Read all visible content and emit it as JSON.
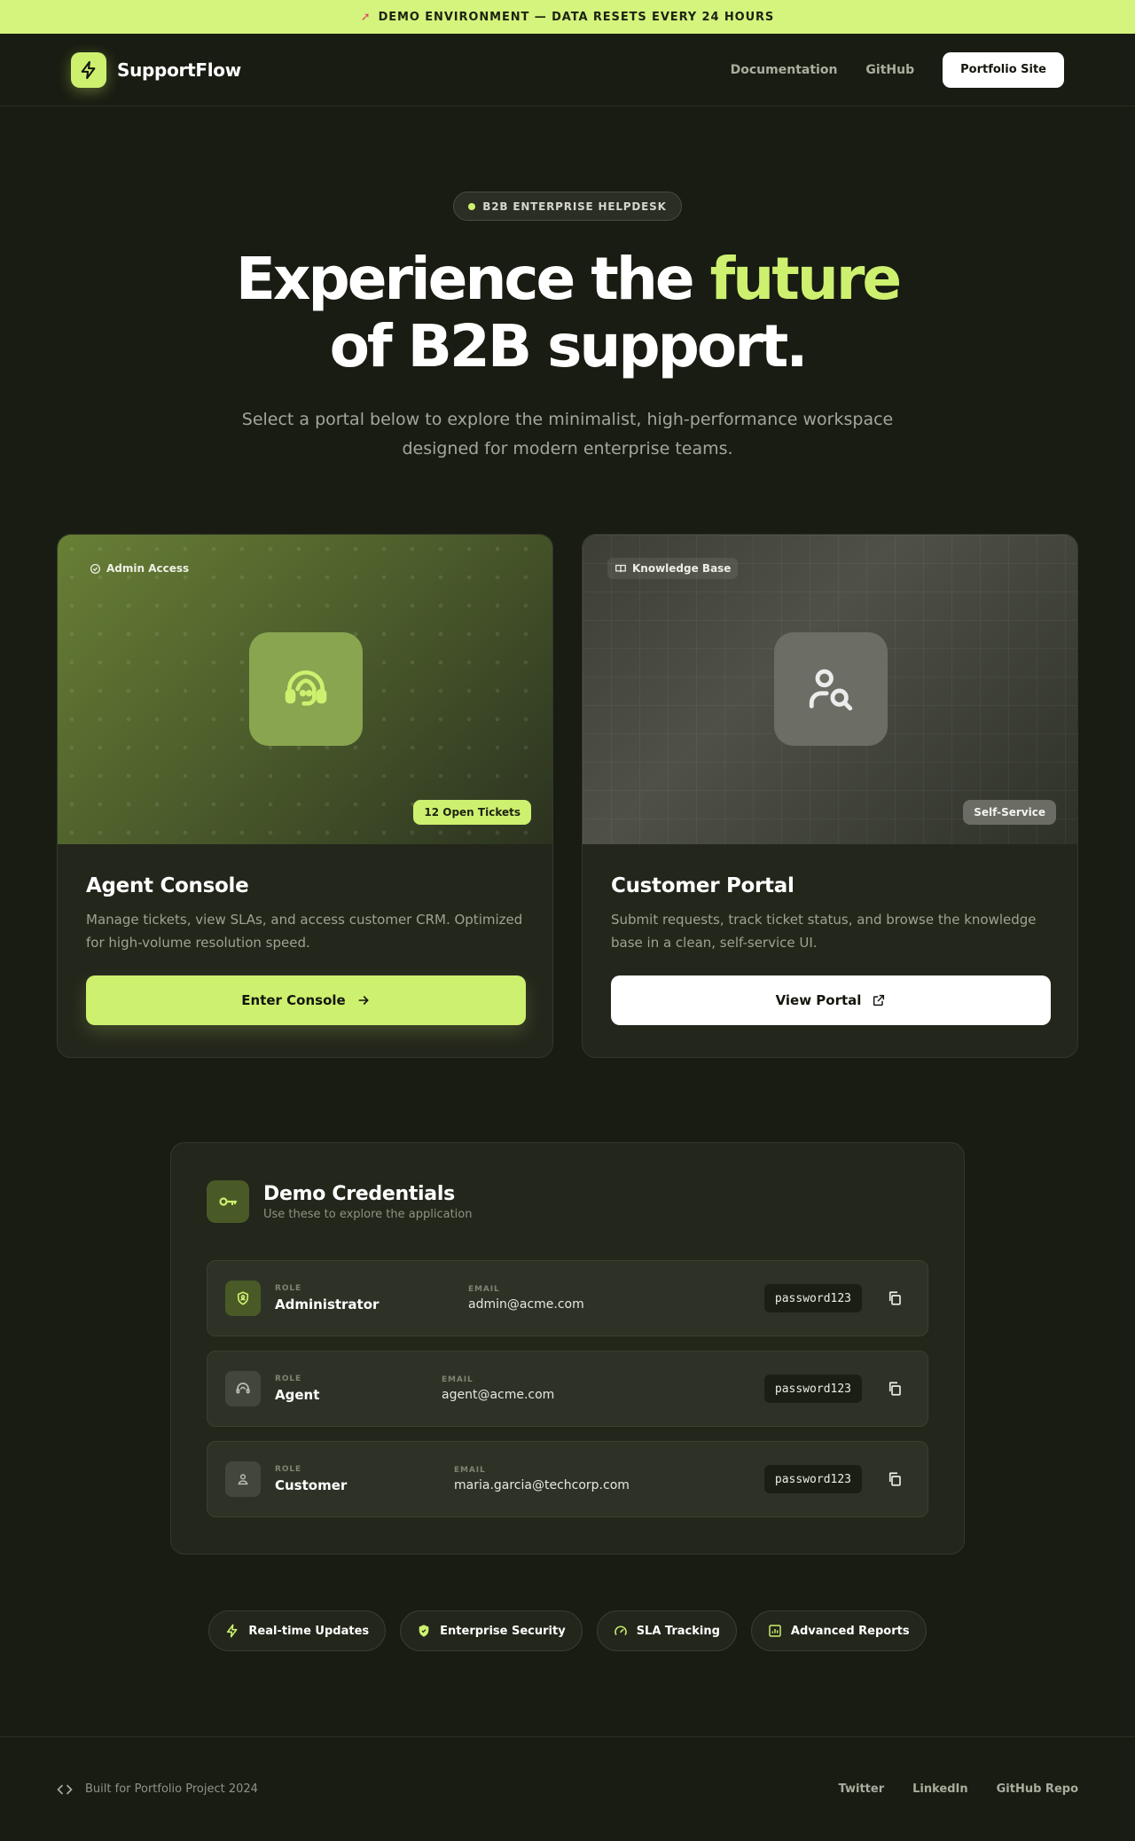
{
  "banner": {
    "text": "DEMO ENVIRONMENT — DATA RESETS EVERY 24 HOURS",
    "icon": "rocket-icon"
  },
  "nav": {
    "brand": "SupportFlow",
    "links": [
      "Documentation",
      "GitHub"
    ],
    "cta": "Portfolio Site"
  },
  "hero": {
    "pill": "B2B ENTERPRISE HELPDESK",
    "title_part1": "Experience the ",
    "title_accent": "future",
    "title_line2": "of B2B support.",
    "subtitle": "Select a portal below to explore the minimalist, high-performance workspace designed for modern enterprise teams."
  },
  "cards": [
    {
      "tag": "Admin Access",
      "badge": "12 Open Tickets",
      "title": "Agent Console",
      "description": "Manage tickets, view SLAs, and access customer CRM. Optimized for high-volume resolution speed.",
      "button": "Enter Console",
      "icon": "headset-icon"
    },
    {
      "tag": "Knowledge Base",
      "badge": "Self-Service",
      "title": "Customer Portal",
      "description": "Submit requests, track ticket status, and browse the knowledge base in a clean, self-service UI.",
      "button": "View Portal",
      "icon": "user-search-icon"
    }
  ],
  "credentials": {
    "title": "Demo Credentials",
    "subtitle": "Use these to explore the application",
    "role_label": "ROLE",
    "email_label": "EMAIL",
    "rows": [
      {
        "role": "Administrator",
        "email": "admin@acme.com",
        "password": "password123"
      },
      {
        "role": "Agent",
        "email": "agent@acme.com",
        "password": "password123"
      },
      {
        "role": "Customer",
        "email": "maria.garcia@techcorp.com",
        "password": "password123"
      }
    ]
  },
  "features": [
    "Real-time Updates",
    "Enterprise Security",
    "SLA Tracking",
    "Advanced Reports"
  ],
  "footer": {
    "text": "Built for Portfolio Project 2024",
    "links": [
      "Twitter",
      "LinkedIn",
      "GitHub Repo"
    ]
  },
  "colors": {
    "accent": "#cdf06f",
    "background": "#191c12",
    "card": "#23261b"
  }
}
